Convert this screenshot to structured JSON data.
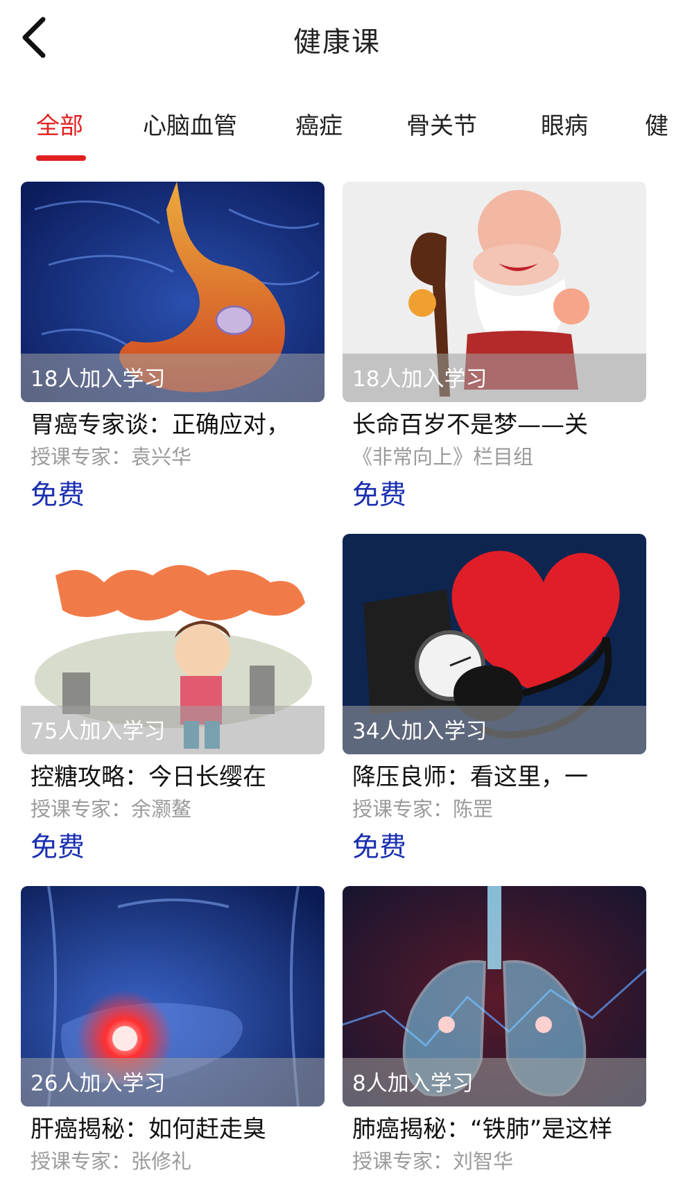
{
  "header": {
    "title": "健康课",
    "back_icon": "chevron-left-icon"
  },
  "tabs": [
    {
      "label": "全部",
      "active": true
    },
    {
      "label": "心脑血管",
      "active": false
    },
    {
      "label": "癌症",
      "active": false
    },
    {
      "label": "骨关节",
      "active": false
    },
    {
      "label": "眼病",
      "active": false
    },
    {
      "label": "健",
      "active": false
    }
  ],
  "colors": {
    "accent": "#e02020",
    "price": "#1a2fb0",
    "muted": "#9a9a9a"
  },
  "courses": [
    {
      "count": "18人加入学习",
      "title": "胃癌专家谈：正确应对，",
      "teacher": "授课专家：袁兴华",
      "price": "免费",
      "image": "stomach-illustration"
    },
    {
      "count": "18人加入学习",
      "title": "长命百岁不是梦——关",
      "teacher": "《非常向上》栏目组",
      "price": "免费",
      "image": "longevity-god-figurine"
    },
    {
      "count": "75人加入学习",
      "title": "控糖攻略：今日长缨在",
      "teacher": "授课专家：余灏鳌",
      "price": "免费",
      "image": "diabetes-cartoon"
    },
    {
      "count": "34人加入学习",
      "title": "降压良师：看这里，一",
      "teacher": "授课专家：陈罡",
      "price": "免费",
      "image": "heart-blood-pressure"
    },
    {
      "count": "26人加入学习",
      "title": "肝癌揭秘：如何赶走臭",
      "teacher": "授课专家：张修礼",
      "price": "",
      "image": "liver-illustration"
    },
    {
      "count": "8人加入学习",
      "title": "肺癌揭秘：“铁肺”是这样",
      "teacher": "授课专家：刘智华",
      "price": "",
      "image": "lungs-illustration"
    }
  ]
}
